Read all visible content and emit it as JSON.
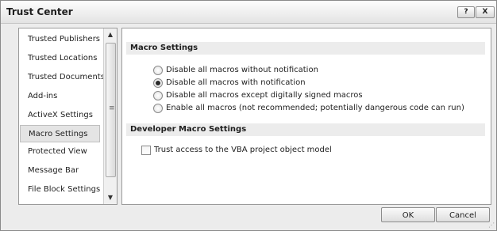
{
  "window": {
    "title": "Trust Center",
    "help_icon": "?",
    "close_icon": "X"
  },
  "sidebar": {
    "items": [
      {
        "label": "Trusted Publishers",
        "selected": false
      },
      {
        "label": "Trusted Locations",
        "selected": false
      },
      {
        "label": "Trusted Documents",
        "selected": false
      },
      {
        "label": "Add-ins",
        "selected": false
      },
      {
        "label": "ActiveX Settings",
        "selected": false
      },
      {
        "label": "Macro Settings",
        "selected": true
      },
      {
        "label": "Protected View",
        "selected": false
      },
      {
        "label": "Message Bar",
        "selected": false
      },
      {
        "label": "File Block Settings",
        "selected": false
      }
    ],
    "scroll_up": "▲",
    "scroll_down": "▼",
    "scroll_grip": "≡"
  },
  "macro_settings": {
    "heading": "Macro Settings",
    "options": [
      {
        "label": "Disable all macros without notification",
        "checked": false
      },
      {
        "label": "Disable all macros with notification",
        "checked": true
      },
      {
        "label": "Disable all macros except digitally signed macros",
        "checked": false
      },
      {
        "label": "Enable all macros (not recommended; potentially dangerous code can run)",
        "checked": false
      }
    ]
  },
  "developer_settings": {
    "heading": "Developer Macro Settings",
    "trust_vba_label": "Trust access to the VBA project object model",
    "trust_vba_checked": false
  },
  "footer": {
    "ok_label": "OK",
    "cancel_label": "Cancel",
    "resize_grip": "⋰"
  }
}
